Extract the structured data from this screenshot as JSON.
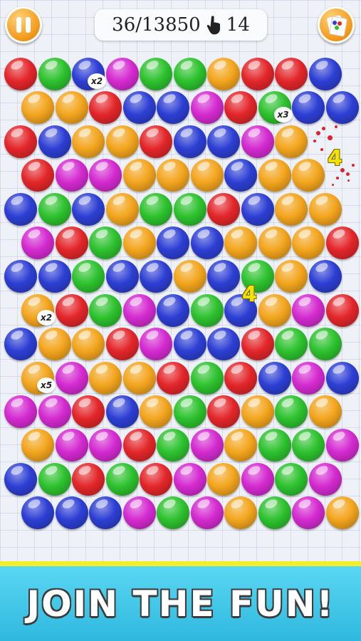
{
  "hud": {
    "score": "36/13850",
    "taps": "14",
    "pause_icon": "pause-icon",
    "menu_icon": "cards-icon",
    "tap_icon": "hand-pointer-icon"
  },
  "colors": {
    "red": "#e3262a",
    "green": "#2dc22e",
    "blue": "#2d3fd4",
    "magenta": "#d42ad0",
    "orange": "#f3a51d"
  },
  "board": {
    "rows": [
      [
        "red",
        "green",
        "blue",
        "magenta",
        "green",
        "green",
        "orange",
        "red",
        "red",
        "blue"
      ],
      [
        "orange",
        "orange",
        "red",
        "blue",
        "blue",
        "magenta",
        "red",
        "green",
        "blue",
        "blue"
      ],
      [
        "red",
        "blue",
        "orange",
        "orange",
        "red",
        "blue",
        "blue",
        "magenta",
        "orange"
      ],
      [
        "red",
        "magenta",
        "magenta",
        "orange",
        "orange",
        "orange",
        "blue",
        "orange",
        "orange"
      ],
      [
        "blue",
        "green",
        "blue",
        "orange",
        "green",
        "green",
        "red",
        "blue",
        "orange",
        "orange"
      ],
      [
        "magenta",
        "red",
        "green",
        "orange",
        "blue",
        "blue",
        "orange",
        "orange",
        "orange",
        "red"
      ],
      [
        "blue",
        "blue",
        "green",
        "blue",
        "blue",
        "orange",
        "blue",
        "green",
        "orange",
        "blue"
      ],
      [
        "orange",
        "red",
        "green",
        "magenta",
        "blue",
        "green",
        "blue",
        "orange",
        "magenta",
        "red"
      ],
      [
        "blue",
        "orange",
        "orange",
        "red",
        "magenta",
        "blue",
        "blue",
        "red",
        "green",
        "green"
      ],
      [
        "orange",
        "magenta",
        "orange",
        "orange",
        "red",
        "green",
        "red",
        "blue",
        "magenta",
        "blue"
      ],
      [
        "magenta",
        "magenta",
        "red",
        "blue",
        "orange",
        "green",
        "red",
        "orange",
        "green",
        "orange"
      ],
      [
        "orange",
        "magenta",
        "magenta",
        "red",
        "green",
        "magenta",
        "orange",
        "green",
        "green",
        "magenta"
      ],
      [
        "blue",
        "green",
        "red",
        "green",
        "red",
        "magenta",
        "orange",
        "magenta",
        "green",
        "magenta"
      ],
      [
        "blue",
        "blue",
        "blue",
        "magenta",
        "green",
        "magenta",
        "orange",
        "green",
        "magenta",
        "orange"
      ]
    ],
    "multipliers": [
      {
        "row": 0,
        "col": 2,
        "label": "x2"
      },
      {
        "row": 1,
        "col": 7,
        "label": "x3"
      },
      {
        "row": 7,
        "col": 0,
        "label": "x2"
      },
      {
        "row": 9,
        "col": 0,
        "label": "x5"
      }
    ],
    "score_popups": [
      "4",
      "4"
    ]
  },
  "banner": {
    "text": "JOIN THE FUN!"
  }
}
